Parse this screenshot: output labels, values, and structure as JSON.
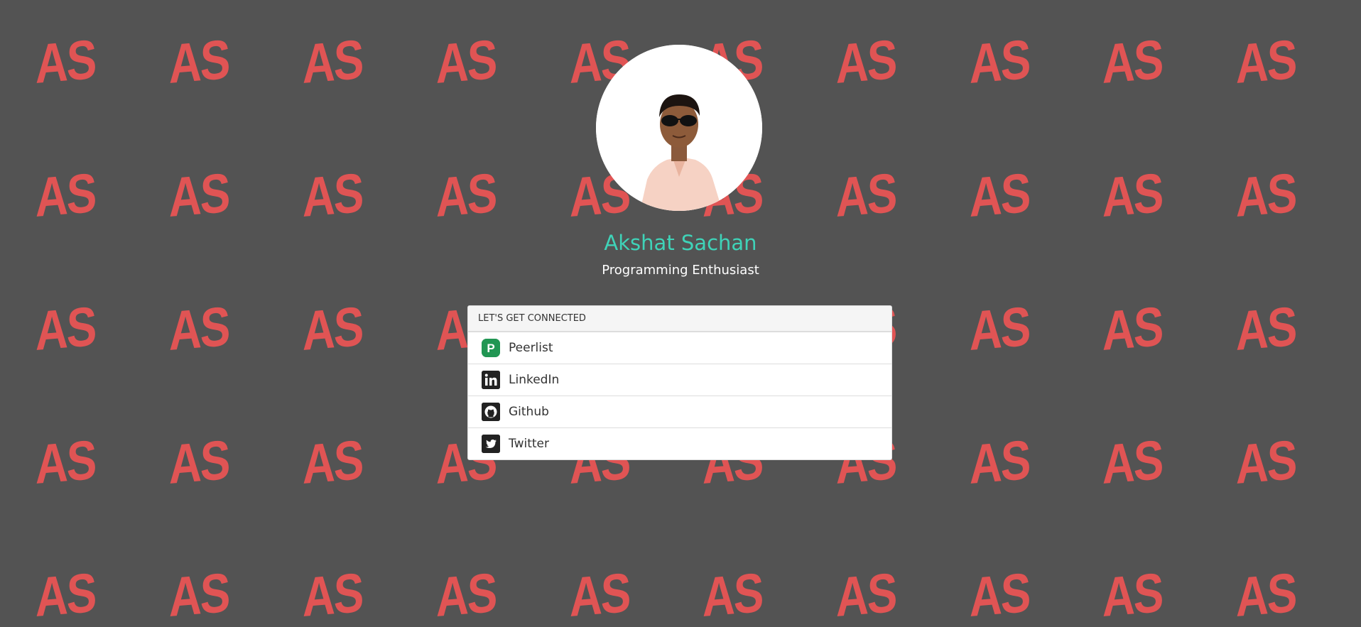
{
  "background": {
    "color": "#535353",
    "pattern_text": "AS",
    "pattern_color": "#e05454"
  },
  "profile": {
    "name": "Akshat Sachan",
    "name_color": "#3fd3b8",
    "tagline": "Programming Enthusiast"
  },
  "connect": {
    "header": "LET'S GET CONNECTED",
    "links": [
      {
        "label": "Peerlist",
        "icon": "peerlist-icon",
        "icon_color": "#219653"
      },
      {
        "label": "LinkedIn",
        "icon": "linkedin-icon",
        "icon_color": "#222222"
      },
      {
        "label": "Github",
        "icon": "github-icon",
        "icon_color": "#222222"
      },
      {
        "label": "Twitter",
        "icon": "twitter-icon",
        "icon_color": "#222222"
      }
    ]
  }
}
